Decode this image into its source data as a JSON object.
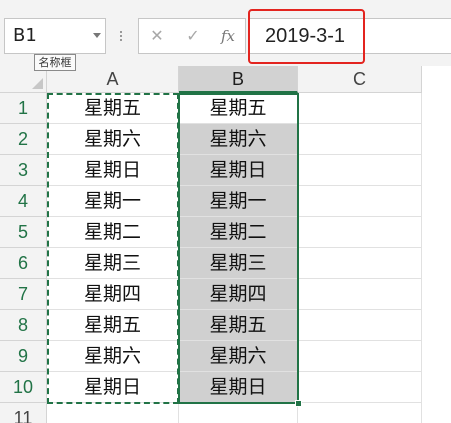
{
  "name_box": {
    "value": "B1"
  },
  "tooltip": {
    "text": "名称框"
  },
  "formula_bar": {
    "cancel_glyph": "✕",
    "enter_glyph": "✓",
    "function_glyph": "fx",
    "value": "2019-3-1"
  },
  "columns": [
    "A",
    "B",
    "C"
  ],
  "rows": [
    "1",
    "2",
    "3",
    "4",
    "5",
    "6",
    "7",
    "8",
    "9",
    "10",
    "11"
  ],
  "column_a": [
    "星期五",
    "星期六",
    "星期日",
    "星期一",
    "星期二",
    "星期三",
    "星期四",
    "星期五",
    "星期六",
    "星期日"
  ],
  "column_b": [
    "星期五",
    "星期六",
    "星期日",
    "星期一",
    "星期二",
    "星期三",
    "星期四",
    "星期五",
    "星期六",
    "星期日"
  ],
  "colors": {
    "accent": "#217346",
    "highlight": "#e3241f"
  }
}
